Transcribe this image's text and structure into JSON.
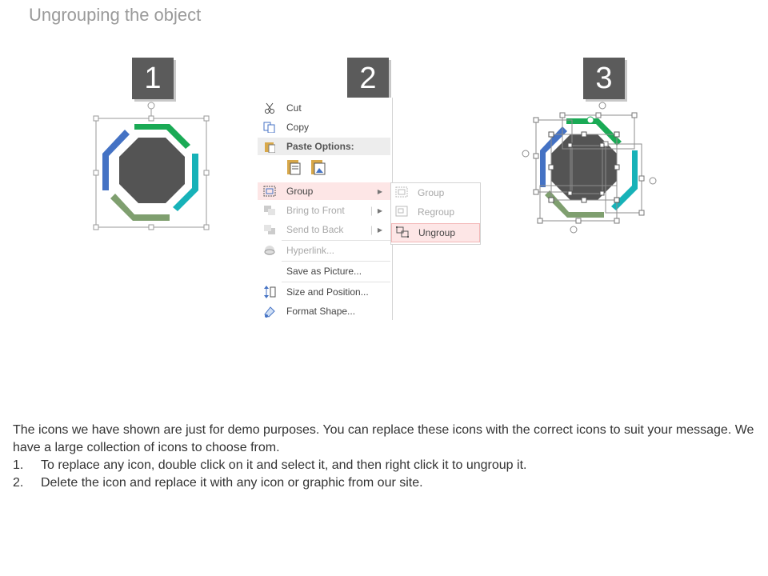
{
  "title": "Ungrouping the object",
  "steps": [
    "1",
    "2",
    "3"
  ],
  "context_menu": {
    "items": [
      {
        "label": "Cut",
        "icon": "scissors-icon",
        "state": "normal"
      },
      {
        "label": "Copy",
        "icon": "copy-icon",
        "state": "normal"
      },
      {
        "label": "Paste Options:",
        "icon": "paste-icon",
        "state": "header"
      },
      {
        "label": "Group",
        "icon": "group-icon",
        "state": "highlighted",
        "submenu": true
      },
      {
        "label": "Bring to Front",
        "icon": "bring-to-front-icon",
        "state": "disabled",
        "submenu": true
      },
      {
        "label": "Send to Back",
        "icon": "send-to-back-icon",
        "state": "disabled",
        "submenu": true
      },
      {
        "label": "Hyperlink...",
        "icon": "hyperlink-icon",
        "state": "disabled"
      },
      {
        "label": "Save as Picture...",
        "icon": "",
        "state": "normal"
      },
      {
        "label": "Size and Position...",
        "icon": "size-position-icon",
        "state": "normal"
      },
      {
        "label": "Format Shape...",
        "icon": "format-shape-icon",
        "state": "normal"
      }
    ],
    "submenu": [
      {
        "label": "Group",
        "icon": "group-icon",
        "state": "disabled"
      },
      {
        "label": "Regroup",
        "icon": "regroup-icon",
        "state": "disabled"
      },
      {
        "label": "Ungroup",
        "icon": "ungroup-icon",
        "state": "highlighted"
      }
    ]
  },
  "description": "The icons we have shown are just for demo purposes. You can replace these icons with the correct icons to suit your message. We have a large collection of icons to choose from.",
  "instructions": [
    {
      "num": "1.",
      "text": "To replace any icon, double click on it and select it, and then right click it to ungroup it."
    },
    {
      "num": "2.",
      "text": "Delete the icon and replace it with any icon or graphic from our site."
    }
  ],
  "colors": {
    "blue": "#4472c4",
    "green": "#1aaa55",
    "teal": "#17b2b8",
    "sage": "#7f9f6f",
    "octagon": "#545454"
  }
}
